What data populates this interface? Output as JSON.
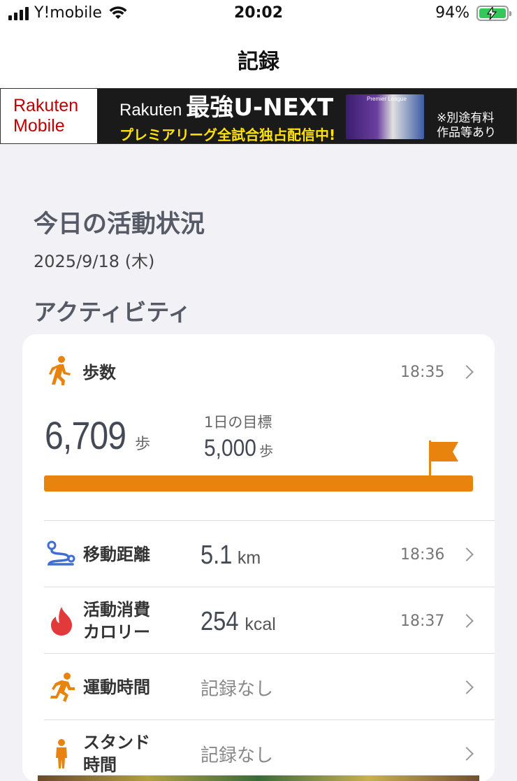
{
  "status_bar": {
    "carrier": "Y!mobile",
    "time": "20:02",
    "battery": "94%"
  },
  "nav": {
    "title": "記録"
  },
  "ad": {
    "logo_line1": "Rakuten",
    "logo_line2": "Mobile",
    "brand": "Rakuten",
    "headline": "最強U-NEXT",
    "subline": "プレミアリーグ全試合独占配信中!",
    "photo_label": "Premier League",
    "note_line1": "※別途有料",
    "note_line2": "作品等あり"
  },
  "summary": {
    "title": "今日の活動状況",
    "date": "2025/9/18 (木)",
    "activity_heading": "アクティビティ"
  },
  "steps": {
    "label": "歩数",
    "time": "18:35",
    "value": "6,709",
    "unit": "歩",
    "goal_label": "1日の目標",
    "goal_value": "5,000",
    "goal_unit": "歩",
    "progress_percent": 100,
    "accent": "#e8830e"
  },
  "rows": [
    {
      "name": "移動距離",
      "value": "5.1",
      "unit": "km",
      "time": "18:36",
      "icon": "route-icon"
    },
    {
      "name_line1": "活動消費",
      "name_line2": "カロリー",
      "value": "254",
      "unit": "kcal",
      "time": "18:37",
      "icon": "flame-icon"
    },
    {
      "name": "運動時間",
      "none": "記録なし",
      "icon": "running-icon"
    },
    {
      "name_line1": "スタンド",
      "name_line2": "時間",
      "none": "記録なし",
      "icon": "standing-icon"
    }
  ]
}
